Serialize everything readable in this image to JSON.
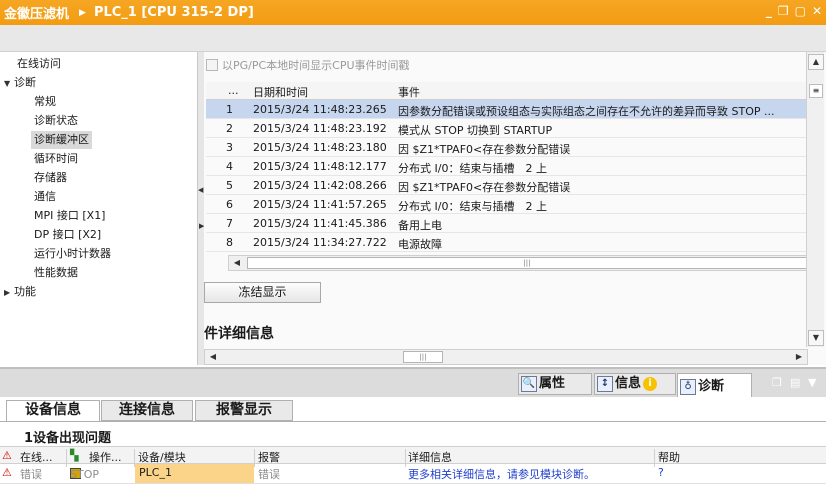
{
  "title_bar": {
    "project": "金徽压滤机",
    "device": "PLC_1 [CPU 315-2 DP]",
    "window_buttons": [
      "_",
      "❐",
      "▢",
      "✕"
    ]
  },
  "left_nav": {
    "items": [
      {
        "label": "在线访问",
        "level": 0
      },
      {
        "label": "诊断",
        "level": 0,
        "expanded": true
      },
      {
        "label": "常规",
        "level": 1
      },
      {
        "label": "诊断状态",
        "level": 1
      },
      {
        "label": "诊断缓冲区",
        "level": 1,
        "selected": true
      },
      {
        "label": "循环时间",
        "level": 1
      },
      {
        "label": "存储器",
        "level": 1
      },
      {
        "label": "通信",
        "level": 1
      },
      {
        "label": "MPI 接口 [X1]",
        "level": 1
      },
      {
        "label": "DP 接口 [X2]",
        "level": 1
      },
      {
        "label": "运行小时计数器",
        "level": 1
      },
      {
        "label": "性能数据",
        "level": 1
      },
      {
        "label": "功能",
        "level": 0,
        "expanded": false
      }
    ]
  },
  "main": {
    "checkbox_label": "以PG/PC本地时间显示CPU事件时间戳",
    "grid": {
      "headers": {
        "num": "...",
        "time": "日期和时间",
        "event": "事件"
      },
      "rows": [
        {
          "n": "1",
          "time": "2015/3/24 11:48:23.265",
          "event": "因参数分配错误或预设组态与实际组态之间存在不允许的差异而导致 STOP ...",
          "selected": true
        },
        {
          "n": "2",
          "time": "2015/3/24 11:48:23.192",
          "event": "模式从 STOP 切换到 STARTUP"
        },
        {
          "n": "3",
          "time": "2015/3/24 11:48:23.180",
          "event": "因 $Z1*TPAF0<存在参数分配错误"
        },
        {
          "n": "4",
          "time": "2015/3/24 11:48:12.177",
          "event": "分布式 I/0：结束与插槽　2 上"
        },
        {
          "n": "5",
          "time": "2015/3/24 11:42:08.266",
          "event": "因 $Z1*TPAF0<存在参数分配错误"
        },
        {
          "n": "6",
          "time": "2015/3/24 11:41:57.265",
          "event": "分布式 I/0：结束与插槽　2 上"
        },
        {
          "n": "7",
          "time": "2015/3/24 11:41:45.386",
          "event": "备用上电"
        },
        {
          "n": "8",
          "time": "2015/3/24 11:34:27.722",
          "event": "电源故障"
        }
      ]
    },
    "freeze_button": "冻结显示",
    "detail_title": "件详细信息"
  },
  "inspector_tabs": {
    "properties": "属性",
    "info": "信息",
    "diagnostics": "诊断"
  },
  "lower_panel": {
    "tabs": [
      "设备信息",
      "连接信息",
      "报警显示"
    ],
    "count_label": "1设备出现问题",
    "columns": [
      "在线...",
      "操作...",
      "设备/模块",
      "报警",
      "详细信息",
      "帮助"
    ],
    "row": {
      "online": "错误",
      "mode": "STOP",
      "device": "PLC_1",
      "alarm": "错误",
      "detail": "更多相关详细信息，请参见模块诊断。",
      "help": "?"
    }
  },
  "colors": {
    "title_orange": "#f39c12",
    "selected_row": "#c7d6ef",
    "plc_cell": "#fbd48a",
    "link_blue": "#1f3fcc"
  }
}
